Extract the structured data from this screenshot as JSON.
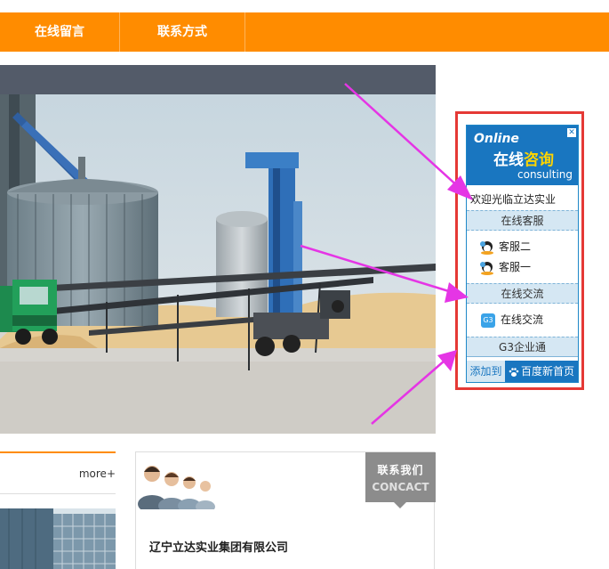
{
  "nav": {
    "items": [
      {
        "label": "在线留言"
      },
      {
        "label": "联系方式"
      }
    ]
  },
  "news": {
    "more_label": "more+"
  },
  "contact": {
    "tab_cn": "联系我们",
    "tab_en": "CONCACT",
    "company_name": "辽宁立达实业集团有限公司"
  },
  "widget": {
    "header_online": "Online",
    "header_cn_prefix": "在线",
    "header_cn_highlight": "咨询",
    "header_en": "consulting",
    "welcome": "欢迎光临立达实业",
    "section_service": "在线客服",
    "service_agents": [
      "客服二",
      "客服一"
    ],
    "section_chat": "在线交流",
    "chat_link": "在线交流",
    "g3_badge": "G3",
    "section_g3": "G3企业通",
    "add_to": "添加到",
    "baidu_home": "百度新首页"
  },
  "colors": {
    "nav_orange": "#ff8c00",
    "widget_blue": "#1976c0",
    "highlight_frame": "#e53935",
    "annotation_arrow": "#e535e5"
  }
}
